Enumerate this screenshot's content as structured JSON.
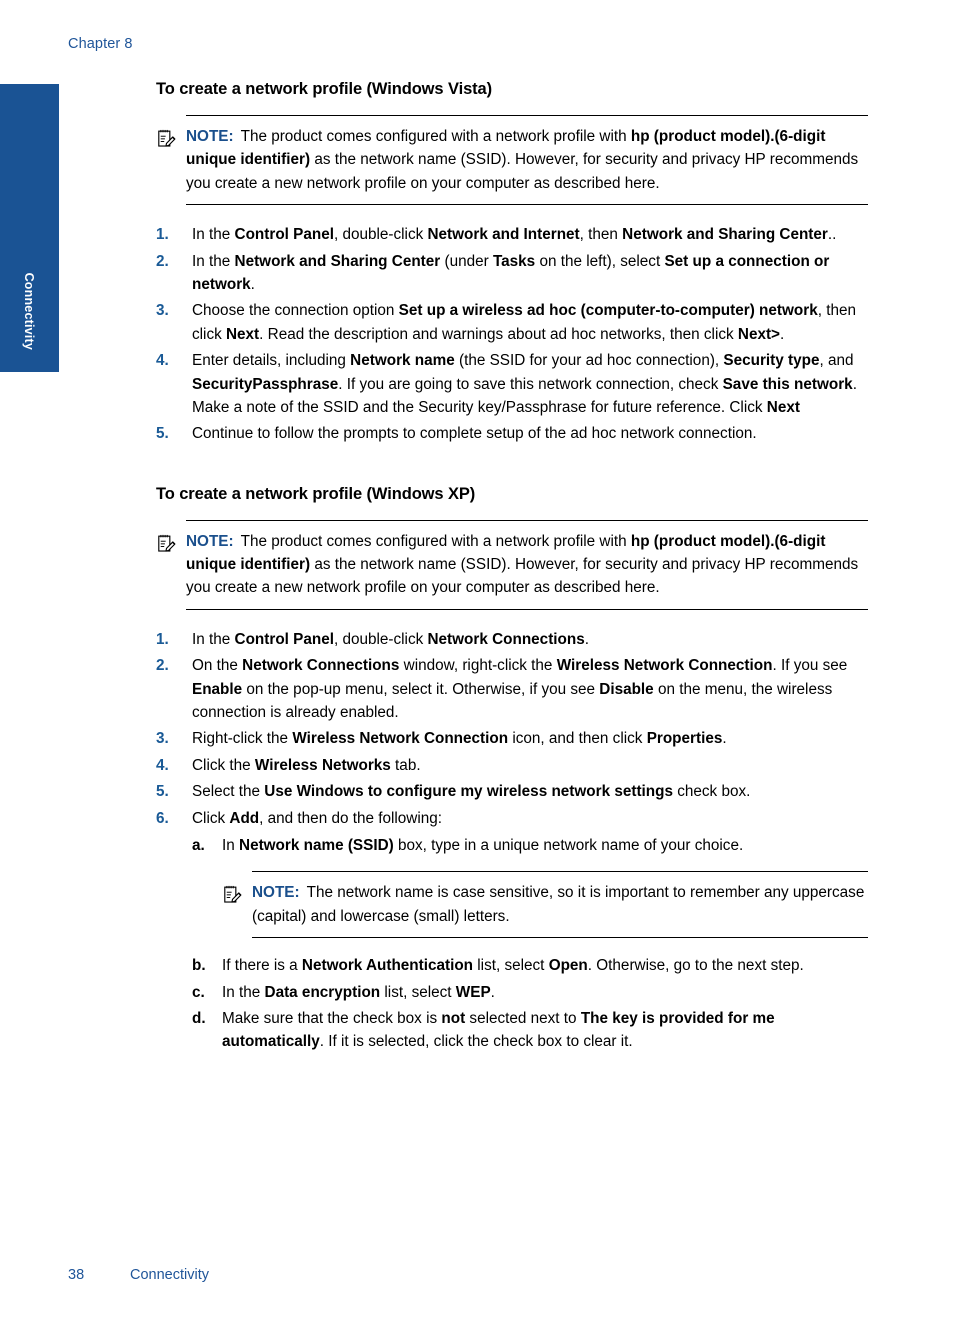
{
  "page": {
    "chapter_header": "Chapter 8",
    "side_tab_label": "Connectivity",
    "footer_page_number": "38",
    "footer_section": "Connectivity",
    "accent_blue": "#1f5599",
    "tab_blue": "#1a5394",
    "note_label_blue": "#1a4f8c",
    "list_marker_blue": "#1a5a96"
  },
  "sections": [
    {
      "heading": "To create a network profile (Windows Vista)",
      "note": {
        "icon": "note-pencil-icon",
        "label": "NOTE:",
        "text_html": "The product comes configured with a network profile with <b>hp (product model).(6-digit unique identifier)</b> as the network name (SSID). However, for security and privacy HP recommends you create a new network profile on your computer as described here."
      },
      "steps": [
        {
          "marker": "1.",
          "text_html": "In the <b>Control Panel</b>, double-click <b>Network and Internet</b>, then <b>Network and Sharing Center</b>.."
        },
        {
          "marker": "2.",
          "text_html": "In the <b>Network and Sharing Center</b> (under <b>Tasks</b> on the left), select <b>Set up a connection or network</b>."
        },
        {
          "marker": "3.",
          "text_html": "Choose the connection option <b>Set up a wireless ad hoc (computer-to-computer) network</b>, then click <b>Next</b>. Read the description and warnings about ad hoc networks, then click <b>Next&gt;</b>."
        },
        {
          "marker": "4.",
          "text_html": "Enter details, including <b>Network name</b> (the SSID for your ad hoc connection), <b>Security type</b>, and <b>SecurityPassphrase</b>. If you are going to save this network connection, check <b>Save this network</b>. Make a note of the SSID and the Security key/Passphrase for future reference. Click <b>Next</b>"
        },
        {
          "marker": "5.",
          "text_html": "Continue to follow the prompts to complete setup of the ad hoc network connection."
        }
      ]
    },
    {
      "heading": "To create a network profile (Windows XP)",
      "note": {
        "icon": "note-pencil-icon",
        "label": "NOTE:",
        "text_html": "The product comes configured with a network profile with <b>hp (product model).(6-digit unique identifier)</b> as the network name (SSID). However, for security and privacy HP recommends you create a new network profile on your computer as described here."
      },
      "steps": [
        {
          "marker": "1.",
          "text_html": "In the <b>Control Panel</b>, double-click <b>Network Connections</b>."
        },
        {
          "marker": "2.",
          "text_html": "On the <b>Network Connections</b> window, right-click the <b>Wireless Network Connection</b>. If you see <b>Enable</b> on the pop-up menu, select it. Otherwise, if you see <b>Disable</b> on the menu, the wireless connection is already enabled."
        },
        {
          "marker": "3.",
          "text_html": "Right-click the <b>Wireless Network Connection</b> icon, and then click <b>Properties</b>."
        },
        {
          "marker": "4.",
          "text_html": "Click the <b>Wireless Networks</b> tab."
        },
        {
          "marker": "5.",
          "text_html": "Select the <b>Use Windows to configure my wireless network settings</b> check box."
        },
        {
          "marker": "6.",
          "text_html": "Click <b>Add</b>, and then do the following:",
          "substeps": [
            {
              "marker": "a.",
              "text_html": "In <b>Network name (SSID)</b> box, type in a unique network name of your choice.",
              "note": {
                "icon": "note-pencil-icon",
                "label": "NOTE:",
                "text_html": "The network name is case sensitive, so it is important to remember any uppercase (capital) and lowercase (small) letters."
              }
            },
            {
              "marker": "b.",
              "text_html": "If there is a <b>Network Authentication</b> list, select <b>Open</b>. Otherwise, go to the next step."
            },
            {
              "marker": "c.",
              "text_html": "In the <b>Data encryption</b> list, select <b>WEP</b>."
            },
            {
              "marker": "d.",
              "text_html": "Make sure that the check box is <b>not</b> selected next to <b>The key is provided for me automatically</b>. If it is selected, click the check box to clear it."
            }
          ]
        }
      ]
    }
  ]
}
